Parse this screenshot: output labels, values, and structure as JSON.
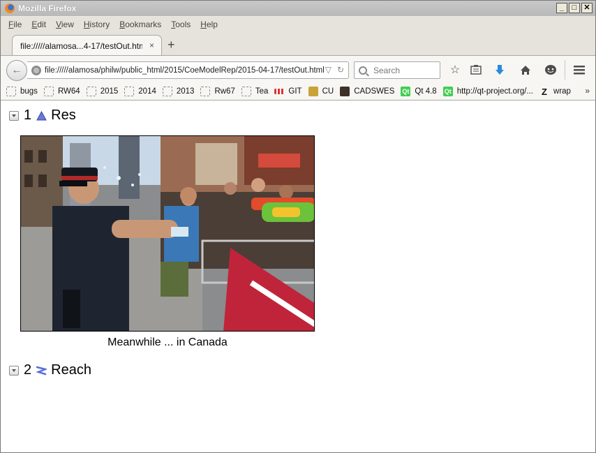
{
  "window": {
    "title": "Mozilla Firefox"
  },
  "menubar": {
    "items": [
      {
        "label": "File",
        "accel": "F",
        "rest": "ile"
      },
      {
        "label": "Edit",
        "accel": "E",
        "rest": "dit"
      },
      {
        "label": "View",
        "accel": "V",
        "rest": "iew"
      },
      {
        "label": "History",
        "accel": "H",
        "rest": "istory"
      },
      {
        "label": "Bookmarks",
        "accel": "B",
        "rest": "ookmarks"
      },
      {
        "label": "Tools",
        "accel": "T",
        "rest": "ools"
      },
      {
        "label": "Help",
        "accel": "H",
        "rest": "elp"
      }
    ]
  },
  "tab": {
    "label": "file://///alamosa...4-17/testOut.html",
    "close": "×"
  },
  "newtab": {
    "label": "+"
  },
  "navbar": {
    "url": "file://///alamosa/philw/public_html/2015/CoeModelRep/2015-04-17/testOut.html",
    "search_placeholder": "Search"
  },
  "bookmarks": {
    "items": [
      {
        "label": "bugs",
        "icon": "folder-dashed-icon"
      },
      {
        "label": "RW64",
        "icon": "folder-dashed-icon"
      },
      {
        "label": "2015",
        "icon": "folder-dashed-icon"
      },
      {
        "label": "2014",
        "icon": "folder-dashed-icon"
      },
      {
        "label": "2013",
        "icon": "folder-dashed-icon"
      },
      {
        "label": "Rw67",
        "icon": "folder-dashed-icon"
      },
      {
        "label": "Tea",
        "icon": "folder-dashed-icon"
      },
      {
        "label": "GIT",
        "icon": "git-icon"
      },
      {
        "label": "CU",
        "icon": "cu-icon"
      },
      {
        "label": "CADSWES",
        "icon": "cadswes-icon"
      },
      {
        "label": "Qt 4.8",
        "icon": "qt-icon"
      },
      {
        "label": "http://qt-project.org/...",
        "icon": "qt-icon"
      },
      {
        "label": "wrap",
        "icon": "z-icon"
      }
    ],
    "more": "»"
  },
  "content": {
    "section1": {
      "number": "1",
      "title": "Res"
    },
    "figure": {
      "caption": "Meanwhile ... in Canada"
    },
    "section2": {
      "number": "2",
      "title": "Reach"
    }
  }
}
